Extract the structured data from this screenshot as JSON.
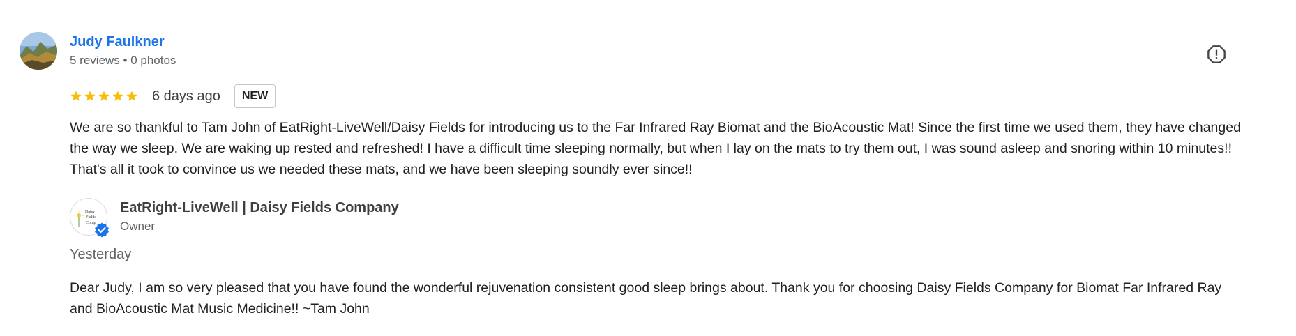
{
  "review": {
    "reviewer": {
      "name": "Judy Faulkner",
      "meta": "5 reviews • 0 photos",
      "avatar_icon": "landscape-photo-icon"
    },
    "report_icon": "report-flag-icon",
    "rating": 5,
    "rating_max": 5,
    "time_ago": "6 days ago",
    "badge": "NEW",
    "text": "We are so thankful to Tam John of EatRight-LiveWell/Daisy Fields for introducing us to the Far Infrared Ray Biomat and the BioAcoustic Mat! Since the first time we used them, they have changed the way we sleep. We are waking up rested and refreshed! I have a difficult time sleeping normally, but when I lay on the mats to try them out, I was sound asleep and snoring within 10 minutes!! That's all it took to convince us we needed these mats, and we have been sleeping soundly ever since!!"
  },
  "owner_reply": {
    "name": "EatRight-LiveWell | Daisy Fields Company",
    "role": "Owner",
    "logo_text": [
      "Daisy",
      "Fields",
      "Comp"
    ],
    "time": "Yesterday",
    "text": "Dear Judy, I am so very pleased that you have found the wonderful rejuvenation consistent good sleep brings about. Thank you for choosing Daisy Fields Company for Biomat Far Infrared Ray and BioAcoustic Mat Music Medicine!! ~Tam John"
  },
  "colors": {
    "link": "#1a73e8",
    "star": "#fbbc04",
    "verified": "#1a73e8",
    "text": "#202124",
    "muted": "#5f6368"
  }
}
